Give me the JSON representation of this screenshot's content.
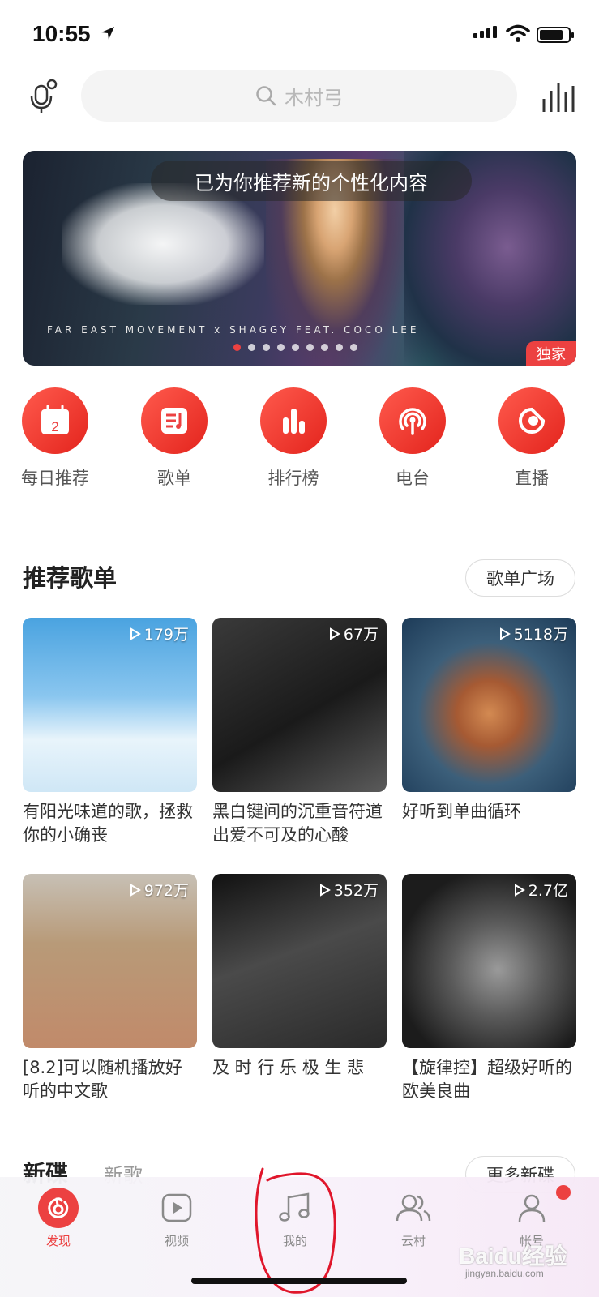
{
  "status_bar": {
    "time": "10:55"
  },
  "search": {
    "placeholder": "木村弓"
  },
  "banner": {
    "notice": "已为你推荐新的个性化内容",
    "caption": "FAR EAST MOVEMENT x SHAGGY FEAT. COCO LEE",
    "badge": "独家",
    "page_count": 9,
    "current_page": 1
  },
  "entries": [
    {
      "label": "每日推荐",
      "icon": "calendar-icon",
      "day": "2"
    },
    {
      "label": "歌单",
      "icon": "playlist-icon"
    },
    {
      "label": "排行榜",
      "icon": "chart-bars-icon"
    },
    {
      "label": "电台",
      "icon": "radio-icon"
    },
    {
      "label": "直播",
      "icon": "live-icon"
    }
  ],
  "recommend": {
    "title": "推荐歌单",
    "more": "歌单广场",
    "playlists": [
      {
        "plays": "179万",
        "title": "有阳光味道的歌，拯救你的小确丧"
      },
      {
        "plays": "67万",
        "title": "黑白键间的沉重音符道出爱不可及的心酸"
      },
      {
        "plays": "5118万",
        "title": "好听到单曲循环"
      },
      {
        "plays": "972万",
        "title": "[8.2]可以随机播放好听的中文歌"
      },
      {
        "plays": "352万",
        "title": "及 时 行 乐 极 生 悲"
      },
      {
        "plays": "2.7亿",
        "title": "【旋律控】超级好听的欧美良曲"
      }
    ]
  },
  "new_section": {
    "title": "新碟",
    "sub": "新歌",
    "more": "更多新碟"
  },
  "tabbar": [
    {
      "label": "发现",
      "icon": "discover-icon",
      "active": true
    },
    {
      "label": "视频",
      "icon": "video-icon"
    },
    {
      "label": "我的",
      "icon": "music-note-icon"
    },
    {
      "label": "云村",
      "icon": "community-icon"
    },
    {
      "label": "帐号",
      "icon": "account-icon"
    }
  ],
  "watermark": {
    "brand": "Baidu经验",
    "url": "jingyan.baidu.com"
  },
  "colors": {
    "accent": "#ec4141",
    "annotation": "#e0162b"
  }
}
